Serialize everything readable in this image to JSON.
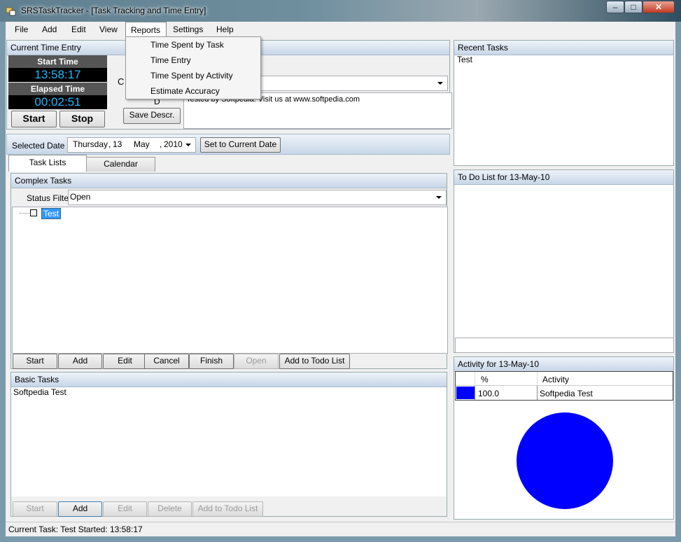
{
  "window": {
    "title": "SRSTaskTracker - [Task Tracking and Time Entry]",
    "minimize": "–",
    "maximize": "□",
    "close": "✕"
  },
  "menu": {
    "items": [
      "File",
      "Add",
      "Edit",
      "View",
      "Reports",
      "Settings",
      "Help"
    ],
    "open_menu": "Reports",
    "reports_items": [
      "Time Spent by Task",
      "Time Entry",
      "Time Spent by Activity",
      "Estimate Accuracy"
    ]
  },
  "time_entry": {
    "header": "Current Time Entry",
    "start_time_label": "Start Time",
    "start_time": "13:58:17",
    "elapsed_label": "Elapsed Time",
    "elapsed": "00:02:51",
    "start_button": "Start",
    "stop_button": "Stop",
    "combo_label_partial": "C",
    "desc_label_partial": "D",
    "description": "Tested by Softpedia. Visit us at www.softpedia.com",
    "save_descr_button": "Save Descr."
  },
  "date_bar": {
    "label": "Selected Date",
    "day_name": "Thursday",
    "day": "13",
    "month": "May",
    "year": "2010",
    "set_current_button": "Set to Current Date"
  },
  "tabs": {
    "task_lists": "Task Lists",
    "calendar": "Calendar",
    "active": "Task Lists"
  },
  "complex_tasks": {
    "header": "Complex Tasks",
    "status_filter_label": "Status Filter",
    "status_filter_value": "Open",
    "tree_items": [
      "Test"
    ],
    "buttons": {
      "start": "Start",
      "add": "Add",
      "edit": "Edit",
      "cancel": "Cancel",
      "finish": "Finish",
      "open": "Open",
      "add_todo": "Add to Todo List"
    }
  },
  "basic_tasks": {
    "header": "Basic Tasks",
    "items": [
      "Softpedia Test"
    ],
    "buttons": {
      "start": "Start",
      "add": "Add",
      "edit": "Edit",
      "delete": "Delete",
      "add_todo": "Add to Todo List"
    }
  },
  "recent_tasks": {
    "header": "Recent Tasks",
    "items": [
      "Test"
    ]
  },
  "todo": {
    "header": "To Do List for 13-May-10"
  },
  "activity": {
    "header": "Activity for 13-May-10",
    "col_percent": "%",
    "col_activity": "Activity",
    "rows": [
      {
        "percent": "100.0",
        "activity": "Softpedia Test",
        "color": "#0000ff"
      }
    ]
  },
  "chart_data": {
    "type": "pie",
    "categories": [
      "Softpedia Test"
    ],
    "values": [
      100.0
    ],
    "colors": [
      "#0000ff"
    ]
  },
  "status_bar": {
    "text": "Current Task: Test Started: 13:58:17"
  },
  "colors": {
    "accent": "#0000ff",
    "lcd_text": "#19b8ff",
    "selection": "#3399ff"
  }
}
